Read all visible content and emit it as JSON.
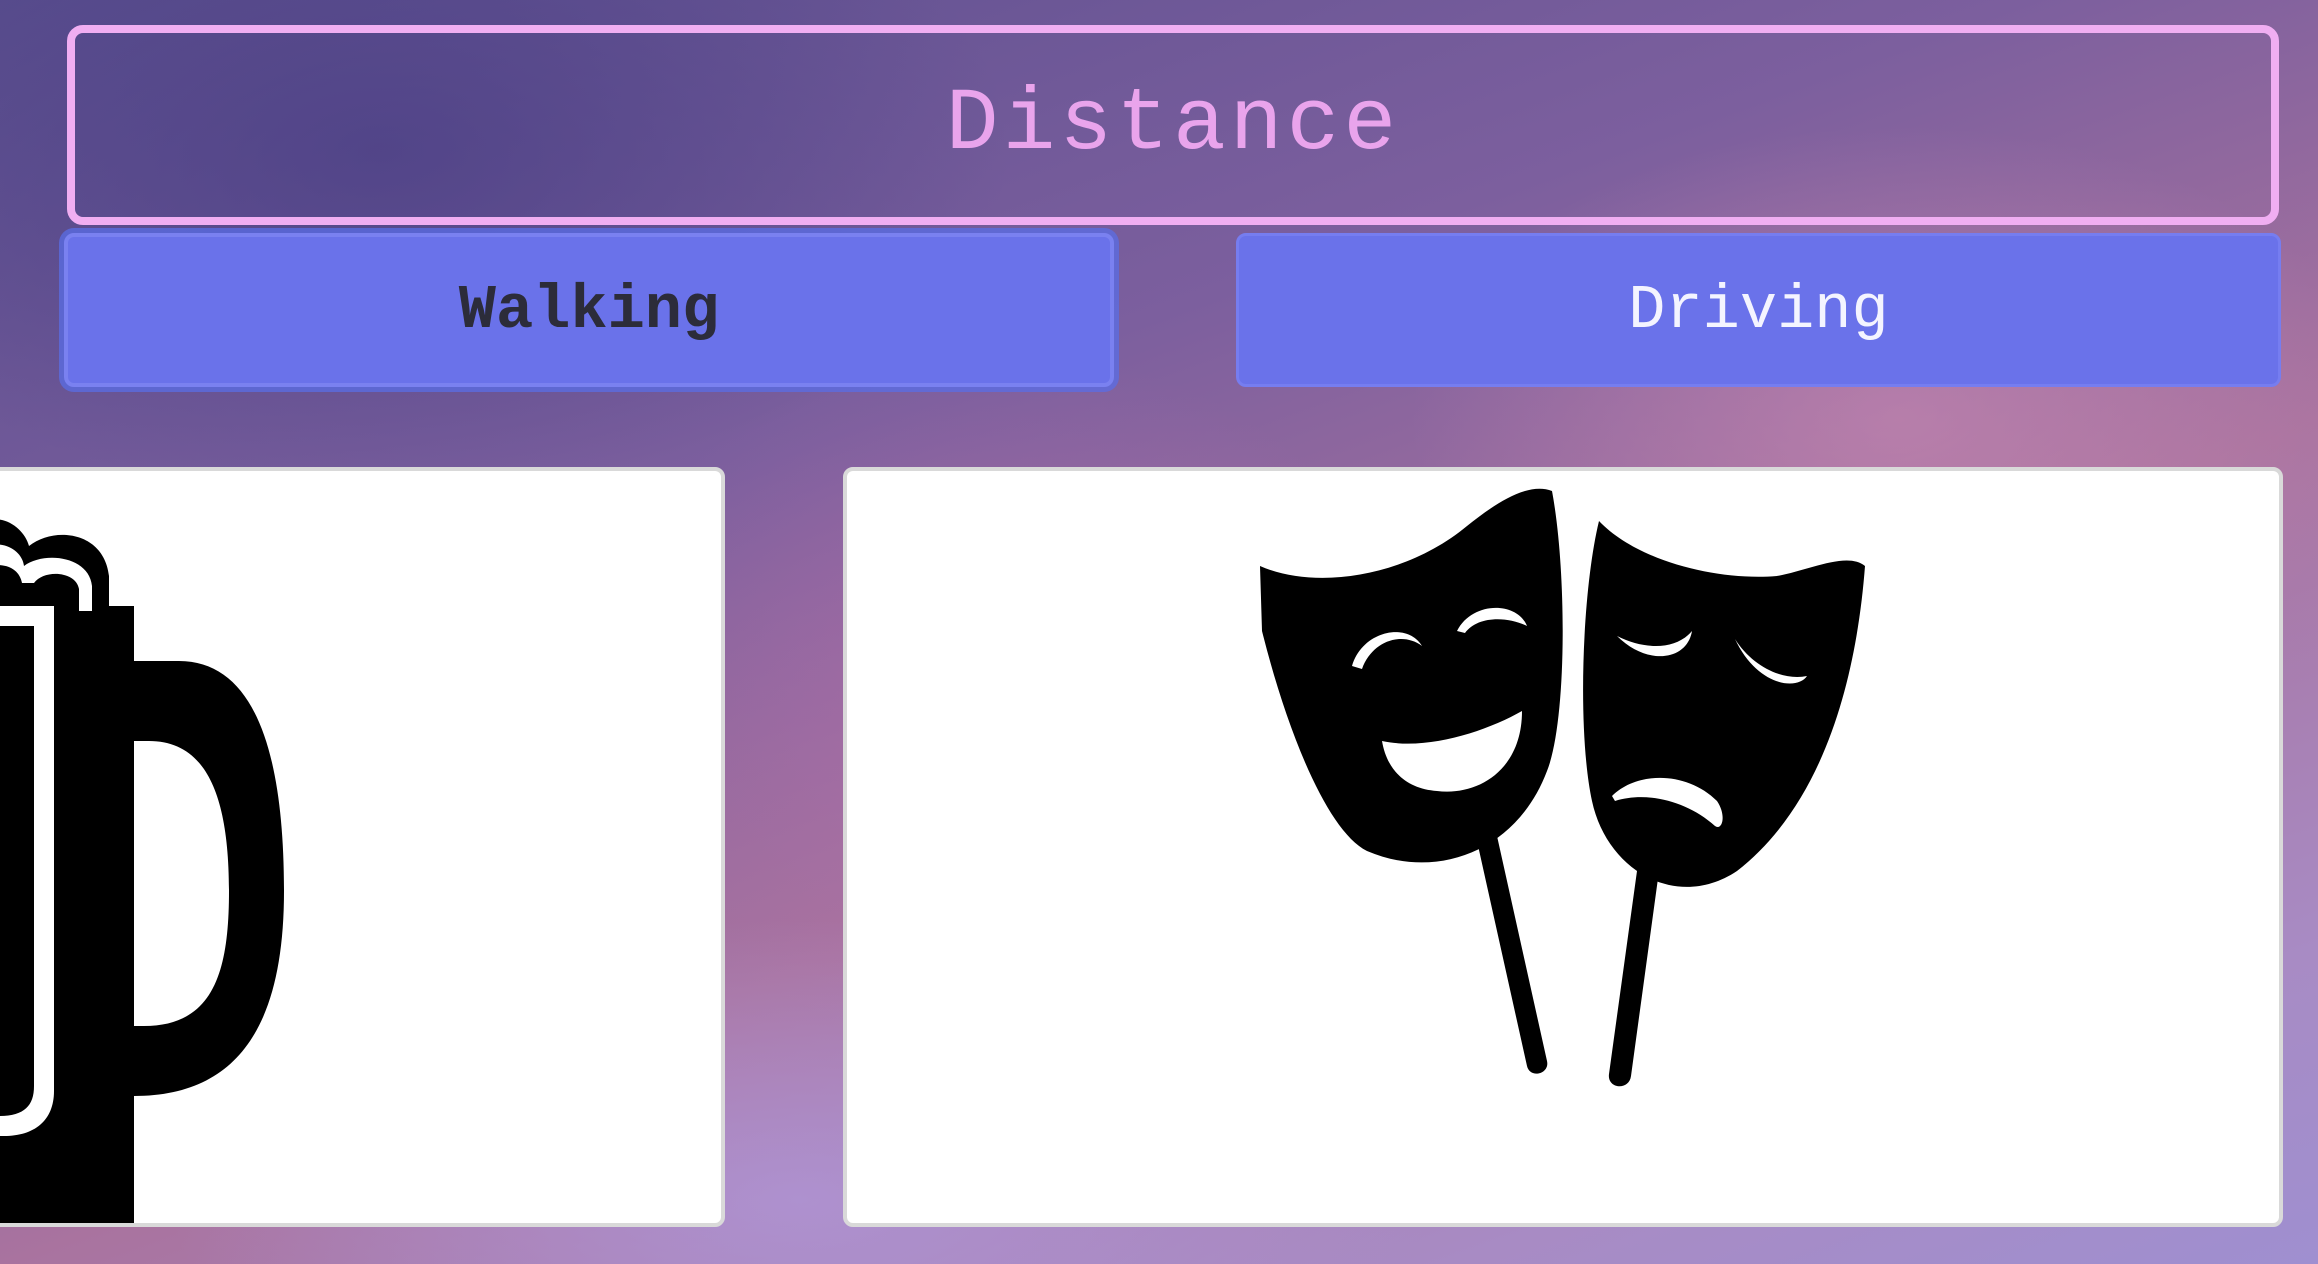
{
  "header": {
    "title": "Distance"
  },
  "tabs": [
    {
      "label": "Walking",
      "selected": true
    },
    {
      "label": "Driving",
      "selected": false
    }
  ],
  "cards": [
    {
      "icon": "beer-mug-icon"
    },
    {
      "icon": "theater-masks-icon"
    }
  ],
  "colors": {
    "title_border": "#f0aef2",
    "title_text": "#e9a4ec",
    "tab_background": "#6a72ea",
    "card_background": "#ffffff"
  }
}
